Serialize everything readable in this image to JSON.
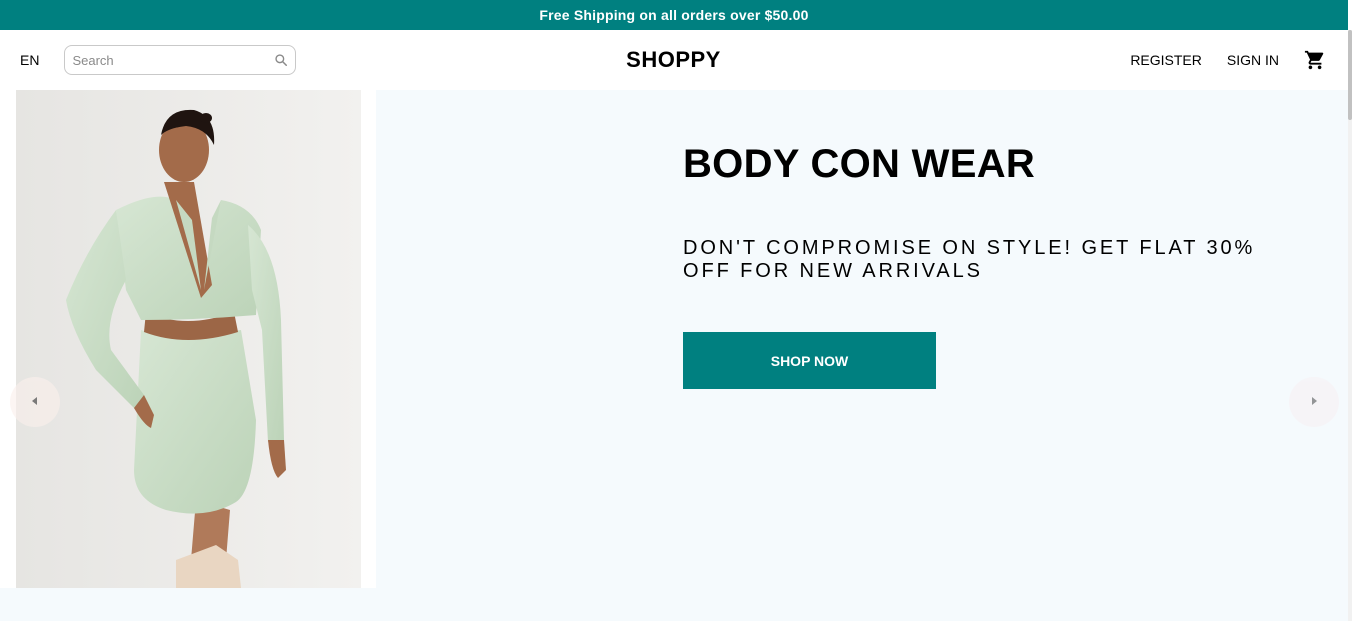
{
  "announcement": {
    "text": "Free Shipping on all orders over $50.00"
  },
  "navbar": {
    "language": "EN",
    "search": {
      "placeholder": "Search",
      "value": ""
    },
    "logo": "SHOPPY",
    "menu": {
      "register": "REGISTER",
      "sign_in": "SIGN IN"
    },
    "icons": {
      "search": "search-icon",
      "cart": "shopping-cart-icon"
    }
  },
  "slider": {
    "current_slide": {
      "title": "BODY CON WEAR",
      "description": "DON'T COMPROMISE ON STYLE! GET FLAT 30% OFF FOR NEW ARRIVALS",
      "button_label": "SHOP NOW",
      "image_alt": "Model wearing mint green blazer dress"
    },
    "arrows": {
      "left": "arrow-left-icon",
      "right": "arrow-right-icon"
    }
  },
  "colors": {
    "accent": "#008080",
    "slide_background": "#f5fafd",
    "text": "#000000"
  }
}
